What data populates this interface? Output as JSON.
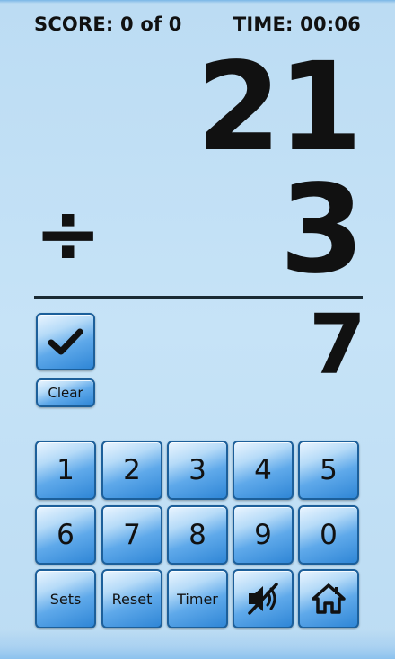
{
  "header": {
    "score": "SCORE: 0 of 0",
    "time": "TIME: 00:06"
  },
  "problem": {
    "operand1": "21",
    "operator": "÷",
    "operand2": "3",
    "answer": "7"
  },
  "controls": {
    "check_icon": "checkmark-icon",
    "clear_label": "Clear"
  },
  "keypad": {
    "row1": [
      "1",
      "2",
      "3",
      "4",
      "5"
    ],
    "row2": [
      "6",
      "7",
      "8",
      "9",
      "0"
    ],
    "row3": {
      "sets_label": "Sets",
      "reset_label": "Reset",
      "timer_label": "Timer",
      "mute_icon": "sound-muted-icon",
      "home_icon": "home-icon"
    }
  },
  "colors": {
    "background": "#bcdcf3",
    "button_blue": "#2f86d6",
    "button_border": "#1c5f9a",
    "text": "#111111"
  }
}
